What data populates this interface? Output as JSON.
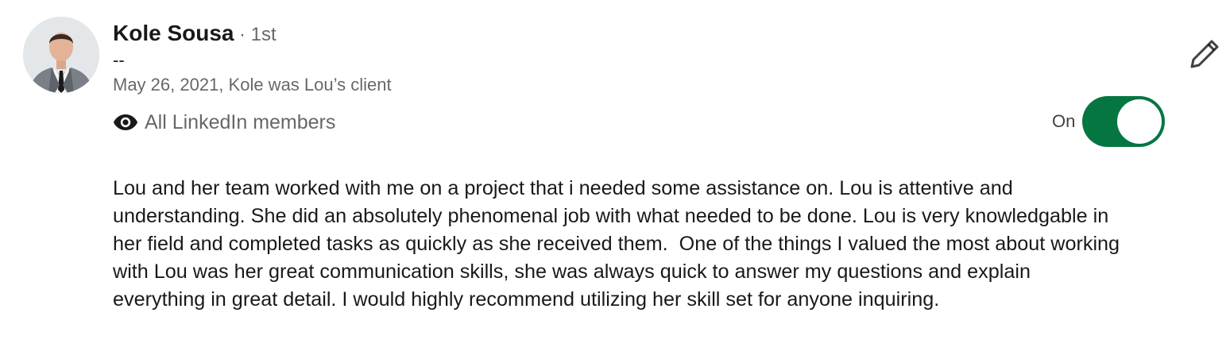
{
  "recommendation": {
    "author": {
      "name": "Kole Sousa",
      "degree": "· 1st",
      "headline": "--",
      "meta": "May 26, 2021, Kole was Lou’s client"
    },
    "visibility": {
      "icon": "eye-icon",
      "label": "All LinkedIn members"
    },
    "toggle": {
      "label": "On",
      "state": true,
      "color": "#057642"
    },
    "edit_icon": "pencil-icon",
    "text": "Lou and her team worked with me on a project that i needed some assistance on. Lou is attentive and understanding. She did an absolutely phenomenal job with what needed to be done. Lou is very knowledgable in her field and completed tasks as quickly as she received them.  One of the things I valued the most about working with Lou was her great communication skills, she was always quick to answer my questions and explain everything in great detail. I would highly recommend utilizing her skill set for anyone inquiring."
  }
}
